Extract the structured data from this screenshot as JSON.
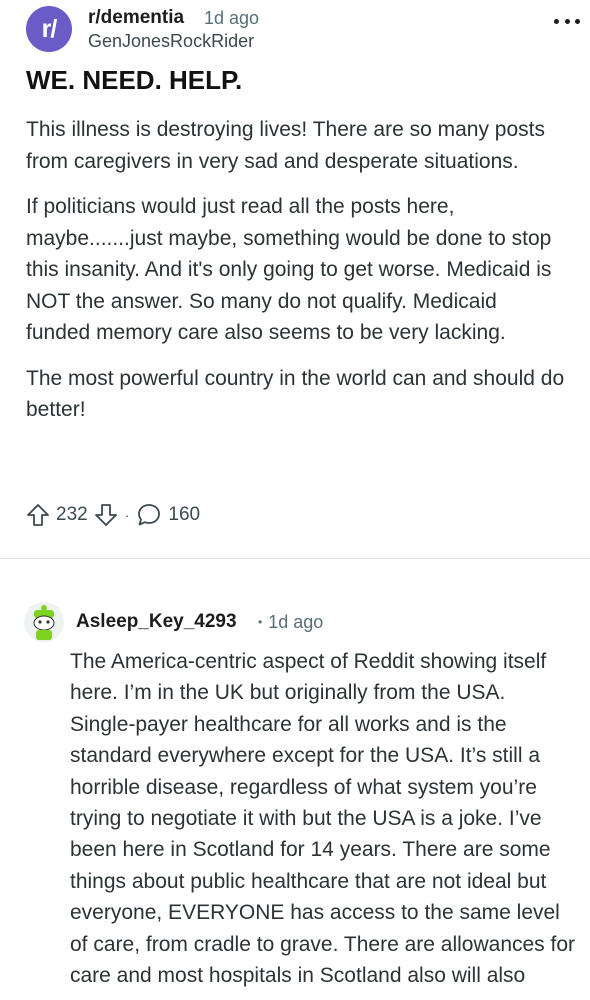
{
  "post": {
    "subreddit": "r/dementia",
    "subreddit_icon_text": "r/",
    "time": "1d ago",
    "author": "GenJonesRockRider",
    "title": "WE. NEED. HELP.",
    "paragraphs": [
      "This illness is destroying lives! There are so many posts from caregivers in very sad and desperate situations.",
      "If politicians would just read all the posts here, maybe.......just maybe, something would be done to stop this insanity. And it's only going to get worse. Medicaid is NOT the answer. So many do not qualify. Medicaid funded memory care also seems to be very lacking.",
      "The most powerful country in the world can and should do better!"
    ],
    "upvotes": "232",
    "separator": "·",
    "comments": "160"
  },
  "comment": {
    "author": "Asleep_Key_4293",
    "separator": "•",
    "time": "1d ago",
    "body": "The America-centric aspect of Reddit showing itself here. I’m in the UK but originally from the USA. Single-payer healthcare for all works and is the standard everywhere except for the USA. It’s still a horrible disease, regardless of what system you’re trying to negotiate it with but the USA is a joke. I’ve been here in Scotland for 14 years. There are some things about public healthcare that are not ideal but everyone, EVERYONE has access to the same level of care, from cradle to grave. There are allowances for care and most hospitals in Scotland also will also"
  },
  "colors": {
    "subreddit_avatar": "#6a5cc6",
    "meta_text": "#576f76",
    "body_text": "#2c3336"
  },
  "icons": [
    "subreddit-avatar",
    "more-options-icon",
    "upvote-icon",
    "downvote-icon",
    "comment-icon",
    "snoo-avatar"
  ]
}
